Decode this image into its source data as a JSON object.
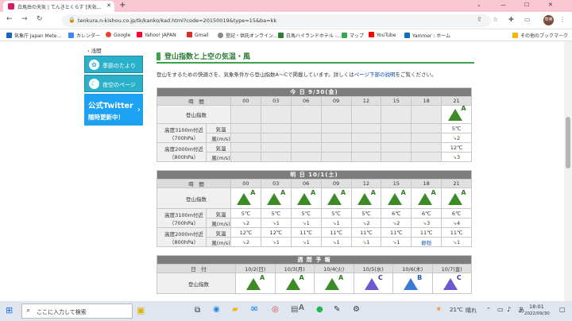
{
  "browser": {
    "tab_title": "白馬岳の天気 | てんきとくらす [天気...",
    "url": "tenkura.n-kishou.co.jp/tk/kanko/kad.html?code=20150019&type=15&ba=kk",
    "avatar_text": "草英",
    "bookmarks": [
      "気象庁 Japan Mete...",
      "カレンダー",
      "Google",
      "Yahoo! JAPAN",
      "Gmail",
      "登記・供託オンライン...",
      "白馬ハイランドホテル -...",
      "マップ",
      "YouTube",
      "Yammer : ホーム"
    ],
    "other_bookmarks": "その他のブックマーク",
    "accent_color": "#f9c6d2"
  },
  "leftnav": {
    "link": "浅間",
    "btn1": "季節のたより",
    "btn2": "夜空のページ",
    "twitter1": "公式Twitter",
    "twitter2": "随時更新中！"
  },
  "main": {
    "heading": "登山指数と上空の気温・風",
    "desc_pre": "登山をするための快適さを、気象条件から登山指数A〜Cで掲載しています。詳しくは",
    "desc_link": "ページ下部の説明",
    "desc_post": "をご覧ください。",
    "label_time": "時　間",
    "label_index": "登山指数",
    "label_3100": "高度3100m付近",
    "label_3100_hpa": "（700hPa）",
    "label_2000": "高度2000m付近",
    "label_2000_hpa": "（800hPa）",
    "label_temp": "気温",
    "label_wind": "風(m/s)",
    "label_date": "日　付",
    "times": [
      "00",
      "03",
      "06",
      "09",
      "12",
      "15",
      "18",
      "21"
    ],
    "today": {
      "title": "今 日 9/30(金)",
      "grade": "A",
      "temp3100": "5℃",
      "wind3100": "2",
      "temp2000": "12℃",
      "wind2000": "3"
    },
    "tomorrow": {
      "title": "明 日 10/1(土)",
      "grades": [
        "A",
        "A",
        "A",
        "A",
        "A",
        "A",
        "A",
        "A"
      ],
      "temp3100": [
        "5℃",
        "5℃",
        "5℃",
        "5℃",
        "5℃",
        "6℃",
        "6℃",
        "6℃"
      ],
      "wind3100": [
        "2",
        "1",
        "1",
        "1",
        "2",
        "2",
        "3",
        "4"
      ],
      "temp2000": [
        "12℃",
        "12℃",
        "11℃",
        "11℃",
        "11℃",
        "11℃",
        "11℃",
        "11℃"
      ],
      "wind2000": [
        "2",
        "1",
        "1",
        "1",
        "1",
        "1",
        "静穏",
        "1"
      ]
    },
    "weekly": {
      "title": "週 間 予 報",
      "dates": [
        "10/2(日)",
        "10/3(月)",
        "10/4(火)",
        "10/5(水)",
        "10/6(木)",
        "10/7(金)"
      ],
      "grades": [
        "A",
        "A",
        "A",
        "C",
        "B",
        "C"
      ]
    }
  },
  "taskbar": {
    "search_placeholder": "ここに入力して検索",
    "temp": "21℃",
    "weather": "晴れ",
    "time": "18:01",
    "date": "2022/09/30",
    "ime": "あ"
  }
}
